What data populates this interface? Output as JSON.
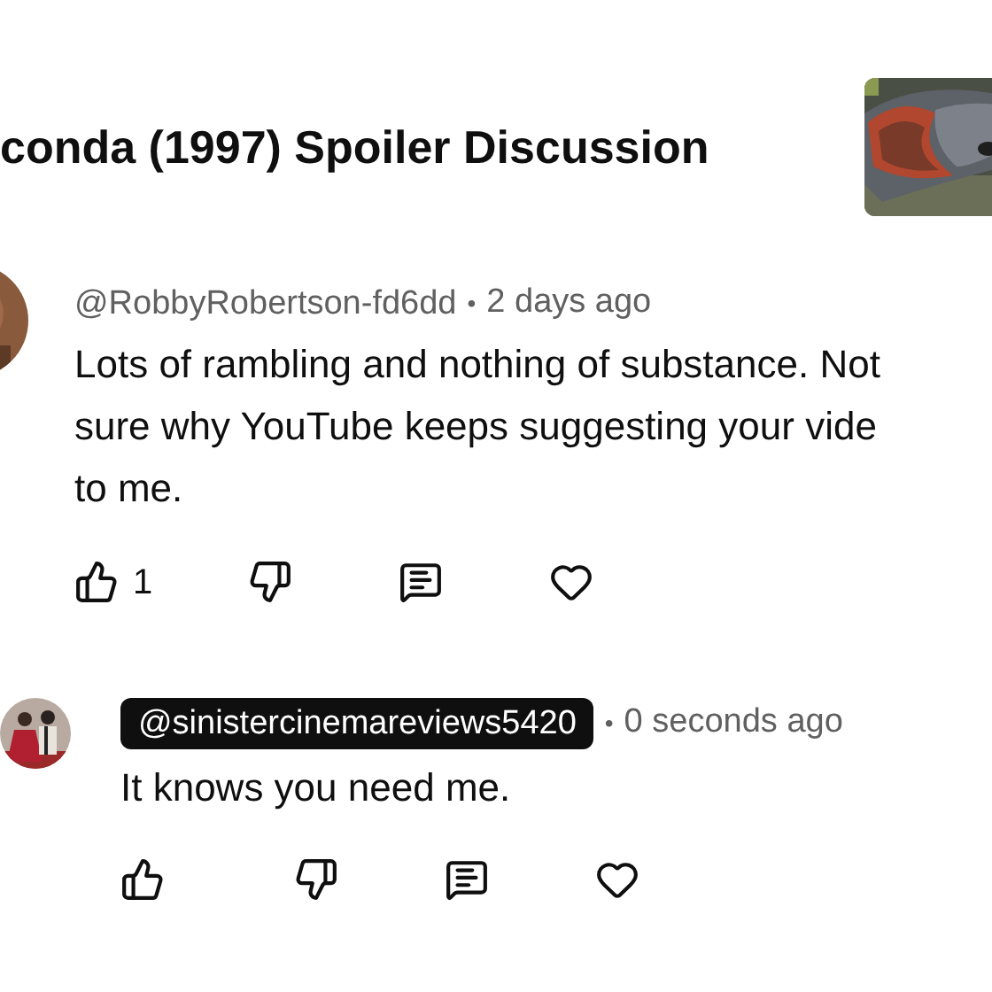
{
  "video_title": "conda (1997) Spoiler Discussion",
  "comments": [
    {
      "kind": "comment",
      "author": "@RobbyRobertson-fd6dd",
      "author_highlighted": false,
      "separator": "•",
      "time": "2 days ago",
      "text_lines": [
        "Lots of rambling and nothing of substance. Not",
        "sure why YouTube keeps suggesting your vide",
        "to me."
      ],
      "actions": [
        {
          "kind": "like",
          "count": "1"
        },
        {
          "kind": "dislike"
        },
        {
          "kind": "reply"
        },
        {
          "kind": "heart"
        }
      ]
    },
    {
      "kind": "reply",
      "author": "@sinistercinemareviews5420",
      "author_highlighted": true,
      "separator": "•",
      "time": "0 seconds ago",
      "text_lines": [
        "It knows you need me."
      ],
      "actions": [
        {
          "kind": "like"
        },
        {
          "kind": "dislike"
        },
        {
          "kind": "reply"
        },
        {
          "kind": "heart"
        }
      ]
    }
  ]
}
